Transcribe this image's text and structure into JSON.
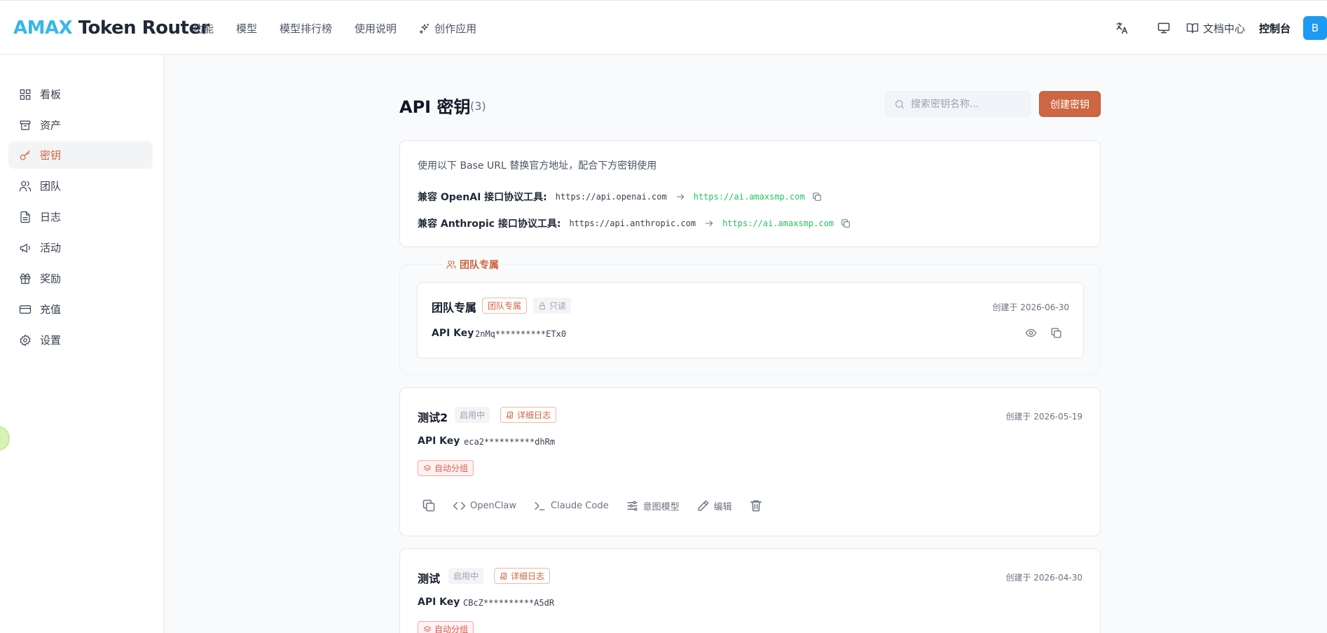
{
  "header": {
    "logo_brand": "AMAX",
    "logo_rest": " Token Router",
    "nav": [
      "功能",
      "模型",
      "模型排行榜",
      "使用说明"
    ],
    "nav_create": "创作应用",
    "docs": "文档中心",
    "console": "控制台",
    "avatar": "B"
  },
  "sidebar": {
    "items": [
      {
        "label": "看板",
        "icon": "dashboard-icon"
      },
      {
        "label": "资产",
        "icon": "archive-icon"
      },
      {
        "label": "密钥",
        "icon": "key-icon",
        "active": true
      },
      {
        "label": "团队",
        "icon": "users-icon"
      },
      {
        "label": "日志",
        "icon": "file-icon"
      },
      {
        "label": "活动",
        "icon": "megaphone-icon"
      },
      {
        "label": "奖励",
        "icon": "gift-icon"
      },
      {
        "label": "充值",
        "icon": "credit-card-icon"
      },
      {
        "label": "设置",
        "icon": "gear-icon"
      }
    ],
    "active_color": "#d0633c"
  },
  "page": {
    "title": "API 密钥",
    "count": "(3)",
    "search_placeholder": "搜索密钥名称...",
    "create_label": "创建密钥"
  },
  "base_url": {
    "description": "使用以下 Base URL 替换官方地址，配合下方密钥使用",
    "rows": [
      {
        "label": "兼容 OpenAI 接口协议工具:",
        "old": "https://api.openai.com",
        "new": "https://ai.amaxsmp.com"
      },
      {
        "label": "兼容 Anthropic 接口协议工具:",
        "old": "https://api.anthropic.com",
        "new": "https://ai.amaxsmp.com"
      }
    ]
  },
  "team_section": {
    "legend": "团队专属",
    "key": {
      "name": "团队专属",
      "tag_team": "团队专属",
      "tag_readonly": "只读",
      "created": "创建于 2026-06-30",
      "api_label": "API Key",
      "api_value": "2nMq**********ETx0"
    }
  },
  "keys": [
    {
      "name": "测试2",
      "status": "启用中",
      "log_tag": "详细日志",
      "created": "创建于 2026-05-19",
      "api_label": "API Key",
      "api_value": "eca2**********dhRm",
      "group": "自动分组",
      "actions": {
        "openclaw": "OpenClaw",
        "claude": "Claude Code",
        "intent": "意图模型",
        "edit": "编辑"
      }
    },
    {
      "name": "测试",
      "status": "启用中",
      "log_tag": "详细日志",
      "created": "创建于 2026-04-30",
      "api_label": "API Key",
      "api_value": "CBcZ**********A5dR",
      "group": "自动分组"
    }
  ],
  "colors": {
    "accent": "#cd6743",
    "brand_blue": "#38b6ea",
    "url_green": "#22c55e"
  }
}
